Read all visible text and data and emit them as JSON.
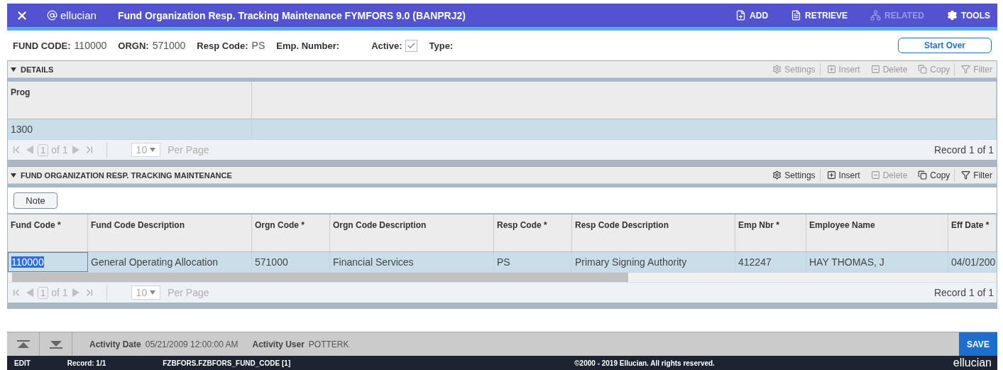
{
  "header": {
    "brand": "ellucian",
    "title": "Fund Organization Resp. Tracking Maintenance FYMFORS 9.0 (BANPRJ2)",
    "actions": [
      {
        "kind": "add",
        "label": "ADD",
        "disabled": false
      },
      {
        "kind": "retrieve",
        "label": "RETRIEVE",
        "disabled": false
      },
      {
        "kind": "related",
        "label": "RELATED",
        "disabled": true
      },
      {
        "kind": "tools",
        "label": "TOOLS",
        "disabled": false
      }
    ]
  },
  "key_block": {
    "fields": [
      {
        "label": "FUND CODE:",
        "value": "110000"
      },
      {
        "label": "ORGN:",
        "value": "571000"
      },
      {
        "label": "Resp Code:",
        "value": "PS"
      },
      {
        "label": "Emp. Number:"
      }
    ],
    "active": {
      "label": "Active:",
      "checked": true
    },
    "type_label": "Type:",
    "start_over": "Start Over"
  },
  "sections": [
    {
      "title": "DETAILS",
      "expanded": true,
      "toolbar": [
        {
          "kind": "settings",
          "label": "Settings",
          "disabled": true
        },
        {
          "kind": "insert",
          "label": "Insert",
          "disabled": true
        },
        {
          "kind": "delete",
          "label": "Delete",
          "disabled": true
        },
        {
          "kind": "copy",
          "label": "Copy",
          "disabled": true
        },
        {
          "kind": "filter",
          "label": "Filter",
          "disabled": true
        }
      ],
      "columns": [
        "Prog"
      ],
      "rows": [
        {
          "selected": true,
          "cells": [
            {
              "text": "1300",
              "focused": false
            }
          ]
        }
      ],
      "pager": {
        "page": "1",
        "of": "of 1",
        "per_page": "10",
        "per_page_label": "Per Page",
        "record": "Record 1 of 1"
      }
    },
    {
      "title": "FUND ORGANIZATION RESP. TRACKING MAINTENANCE",
      "expanded": true,
      "note": "Note",
      "toolbar": [
        {
          "kind": "settings",
          "label": "Settings",
          "disabled": false
        },
        {
          "kind": "insert",
          "label": "Insert",
          "disabled": false
        },
        {
          "kind": "delete",
          "label": "Delete",
          "disabled": true
        },
        {
          "kind": "copy",
          "label": "Copy",
          "disabled": false
        },
        {
          "kind": "filter",
          "label": "Filter",
          "disabled": false
        }
      ],
      "columns": [
        "Fund Code *",
        "Fund Code Description",
        "Orgn Code *",
        "Orgn Code Description",
        "Resp Code *",
        "Resp Code Description",
        "Emp Nbr *",
        "Employee Name",
        "Eff Date *"
      ],
      "rows": [
        {
          "selected": true,
          "cells": [
            {
              "text": "110000",
              "focused": true
            },
            {
              "text": "General Operating Allocation",
              "focused": false
            },
            {
              "text": "571000",
              "focused": false
            },
            {
              "text": "Financial Services",
              "focused": false
            },
            {
              "text": "PS",
              "focused": false
            },
            {
              "text": "Primary Signing  Authority",
              "focused": false
            },
            {
              "text": "412247",
              "focused": false
            },
            {
              "text": "HAY THOMAS, J",
              "focused": false
            },
            {
              "text": "04/01/200",
              "focused": false
            }
          ]
        }
      ],
      "scrollbar": true,
      "pager": {
        "page": "1",
        "of": "of 1",
        "per_page": "10",
        "per_page_label": "Per Page",
        "record": "Record 1 of 1"
      }
    }
  ],
  "activity": [
    {
      "label": "Activity Date",
      "value": "05/21/2009 12:00:00 AM"
    },
    {
      "label": "Activity User",
      "value": "POTTERK"
    }
  ],
  "save": "SAVE",
  "status_bar": {
    "mode": "EDIT",
    "record": "Record: 1/1",
    "block": "FZBFORS.FZBFORS_FUND_CODE [1]",
    "copyright": "©2000 - 2019 Ellucian. All rights reserved.",
    "brand": "ellucian"
  }
}
